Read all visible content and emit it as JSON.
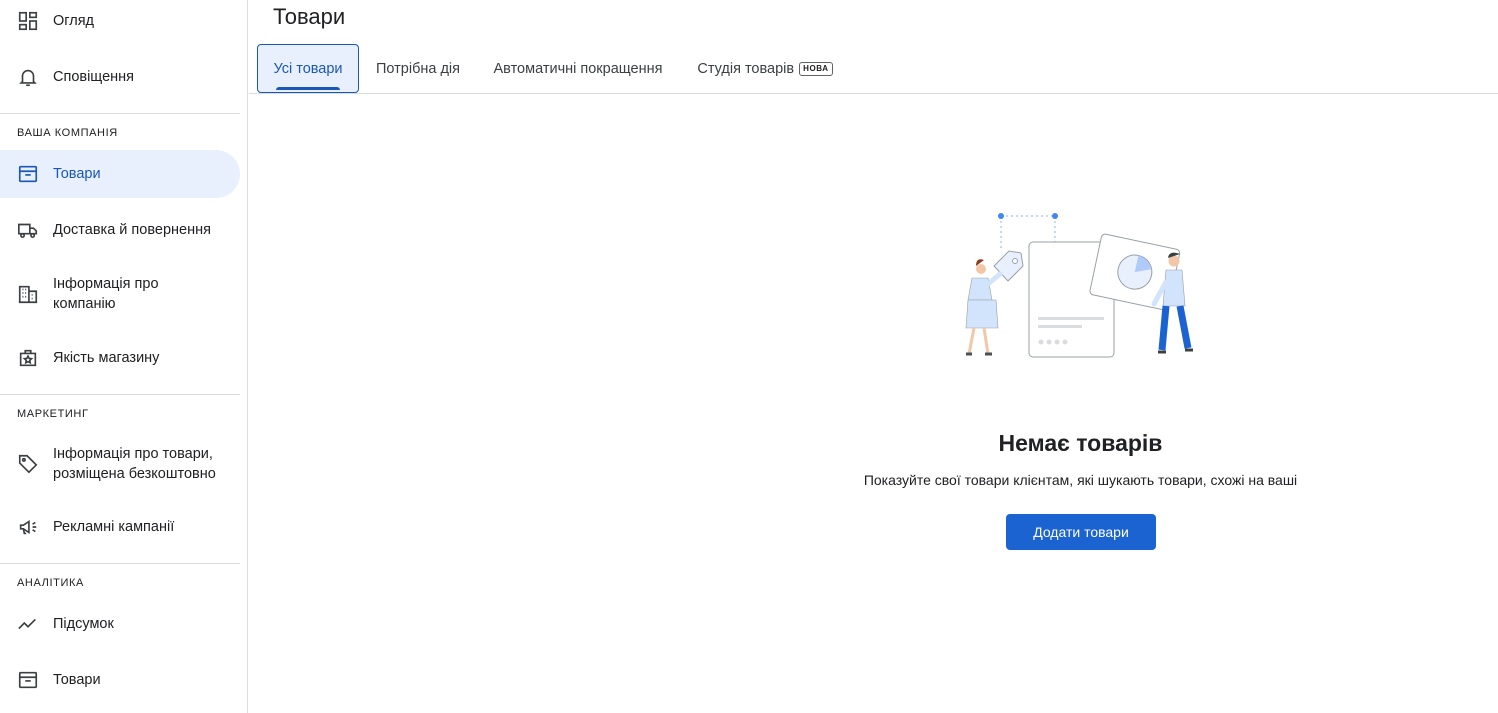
{
  "sidebar": {
    "top_items": [
      {
        "label": "Огляд",
        "icon": "dashboard-icon"
      },
      {
        "label": "Сповіщення",
        "icon": "bell-icon"
      }
    ],
    "sections": [
      {
        "header": "ВАША КОМПАНІЯ",
        "items": [
          {
            "label": "Товари",
            "icon": "archive-box-icon",
            "active": true
          },
          {
            "label": "Доставка й повернення",
            "icon": "truck-icon"
          },
          {
            "label": "Інформація про компанію",
            "icon": "building-icon"
          },
          {
            "label": "Якість магазину",
            "icon": "store-quality-icon"
          }
        ]
      },
      {
        "header": "МАРКЕТИНГ",
        "items": [
          {
            "label": "Інформація про товари, розміщена безкоштовно",
            "icon": "tag-icon"
          },
          {
            "label": "Рекламні кампанії",
            "icon": "megaphone-icon"
          }
        ]
      },
      {
        "header": "АНАЛІТИКА",
        "items": [
          {
            "label": "Підсумок",
            "icon": "trending-line-icon"
          },
          {
            "label": "Товари",
            "icon": "archive-box-icon"
          }
        ]
      }
    ]
  },
  "main": {
    "title": "Товари",
    "tabs": [
      {
        "label": "Усі товари",
        "active": true
      },
      {
        "label": "Потрібна дія"
      },
      {
        "label": "Автоматичні покращення"
      },
      {
        "label": "Студія товарів",
        "badge": "НОВА"
      }
    ],
    "empty_state": {
      "title": "Немає товарів",
      "description": "Показуйте свої товари клієнтам, які шукають товари, схожі на ваші",
      "button_label": "Додати товари"
    }
  },
  "colors": {
    "accent": "#1a57b9",
    "active_bg": "#e8f0fe",
    "button": "#1a63d0",
    "divider": "#dadce0"
  }
}
